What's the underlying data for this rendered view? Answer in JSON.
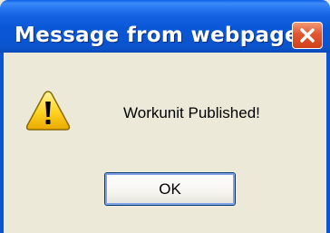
{
  "window": {
    "title": "Message from webpage",
    "close_icon": "close-icon"
  },
  "dialog": {
    "icon": "warning-icon",
    "message": "Workunit Published!",
    "ok_label": "OK"
  },
  "colors": {
    "titlebar": "#0a55d2",
    "close_button": "#e2562f",
    "dialog_background": "#ece9d8",
    "warning_fill": "#ffd21f"
  }
}
